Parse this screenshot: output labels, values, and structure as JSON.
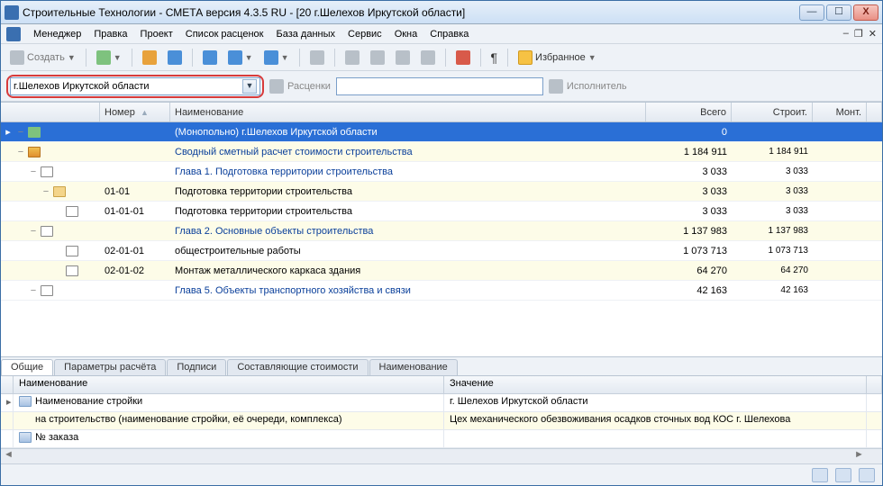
{
  "window_title": "Строительные Технологии - СМЕТА  версия 4.3.5 RU -  [20  г.Шелехов Иркутской области]",
  "menu": [
    "Менеджер",
    "Правка",
    "Проект",
    "Список расценок",
    "База данных",
    "Сервис",
    "Окна",
    "Справка"
  ],
  "toolbar": {
    "create": "Создать",
    "favorites": "Избранное"
  },
  "toolbar2": {
    "selector_value": "г.Шелехов Иркутской области",
    "prices": "Расценки",
    "executor": "Исполнитель"
  },
  "grid": {
    "headers": {
      "number": "Номер",
      "name": "Наименование",
      "total": "Всего",
      "build": "Строит.",
      "assembly": "Монт."
    },
    "rows": [
      {
        "indent": 0,
        "icon": "globe",
        "sel": true,
        "alt": false,
        "num": "",
        "name": "(Монопольно) г.Шелехов Иркутской области",
        "total": "0",
        "build": "",
        "link": false
      },
      {
        "indent": 1,
        "icon": "book",
        "sel": false,
        "alt": true,
        "num": "",
        "name": "Сводный сметный расчет стоимости строительства",
        "total": "1 184 911",
        "build": "1 184 911",
        "link": true
      },
      {
        "indent": 2,
        "icon": "paper",
        "sel": false,
        "alt": false,
        "num": "",
        "name": "Глава 1. Подготовка территории строительства",
        "total": "3 033",
        "build": "3 033",
        "link": true
      },
      {
        "indent": 3,
        "icon": "folder",
        "sel": false,
        "alt": true,
        "num": "01-01",
        "name": "Подготовка территории строительства",
        "total": "3 033",
        "build": "3 033",
        "link": false
      },
      {
        "indent": 4,
        "icon": "doc",
        "sel": false,
        "alt": false,
        "num": "01-01-01",
        "name": "Подготовка территории строительства",
        "total": "3 033",
        "build": "3 033",
        "link": false
      },
      {
        "indent": 2,
        "icon": "paper",
        "sel": false,
        "alt": true,
        "num": "",
        "name": "Глава 2. Основные объекты строительства",
        "total": "1 137 983",
        "build": "1 137 983",
        "link": true
      },
      {
        "indent": 4,
        "icon": "doc",
        "sel": false,
        "alt": false,
        "num": "02-01-01",
        "name": "общестроительные работы",
        "total": "1 073 713",
        "build": "1 073 713",
        "link": false
      },
      {
        "indent": 4,
        "icon": "doc",
        "sel": false,
        "alt": true,
        "num": "02-01-02",
        "name": "Монтаж металлического каркаса здания",
        "total": "64 270",
        "build": "64 270",
        "link": false
      },
      {
        "indent": 2,
        "icon": "paper",
        "sel": false,
        "alt": false,
        "num": "",
        "name": "Глава 5. Объекты транспортного хозяйства и связи",
        "total": "42 163",
        "build": "42 163",
        "link": true
      }
    ]
  },
  "tabs": [
    "Общие",
    "Параметры расчёта",
    "Подписи",
    "Составляющие стоимости",
    "Наименование"
  ],
  "active_tab": 0,
  "detail": {
    "headers": {
      "name": "Наименование",
      "value": "Значение"
    },
    "rows": [
      {
        "mark": "▸",
        "icon": true,
        "alt": false,
        "name": "Наименование стройки",
        "value": "г. Шелехов Иркутской области"
      },
      {
        "mark": "",
        "icon": false,
        "alt": true,
        "name": "на строительство (наименование стройки, её очереди, комплекса)",
        "value": "Цех механического обезвоживания  осадков сточных вод КОС  г. Шелехова"
      },
      {
        "mark": "",
        "icon": true,
        "alt": false,
        "name": "№ заказа",
        "value": ""
      }
    ]
  }
}
